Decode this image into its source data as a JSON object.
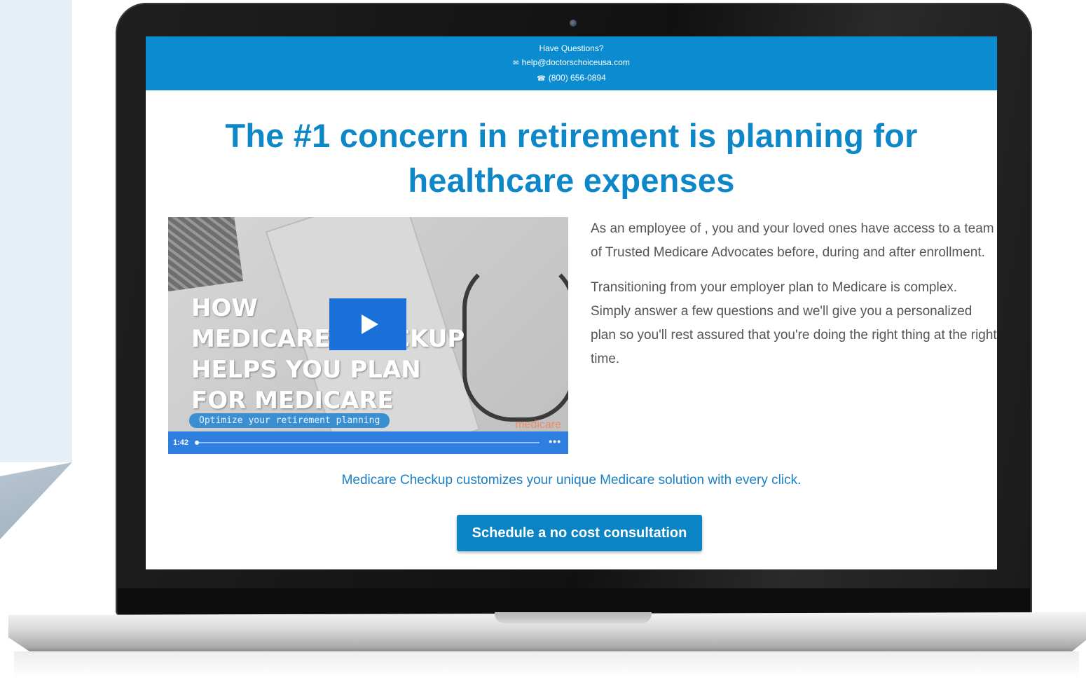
{
  "header": {
    "question": "Have Questions?",
    "email": "help@doctorschoiceusa.com",
    "phone": "(800) 656-0894",
    "email_icon": "envelope-icon",
    "phone_icon": "phone-icon"
  },
  "headline": {
    "line1": "The #1 concern in retirement is planning for",
    "line2": "healthcare expenses"
  },
  "video": {
    "title_lines": [
      "HOW",
      "MEDICARE CHECKUP",
      "HELPS YOU PLAN",
      "FOR MEDICARE"
    ],
    "subtitle": "Optimize your retirement planning",
    "brand": "medicare",
    "duration": "1:42",
    "more": "•••"
  },
  "body": {
    "paragraph1": "As an employee of , you and your loved ones have access to a team of Trusted Medicare Advocates before, during and after enrollment.",
    "paragraph2": "Transitioning from your employer plan to Medicare is complex. Simply answer a few questions and we'll give you a personalized plan so you'll rest assured that you're doing the right thing at the right time."
  },
  "tagline": "Medicare Checkup customizes your unique Medicare solution with every click.",
  "cta": {
    "label": "Schedule a no cost consultation"
  },
  "colors": {
    "topbar": "#0b8bd0",
    "headline": "#0d87c8",
    "button": "#0b84c6"
  }
}
